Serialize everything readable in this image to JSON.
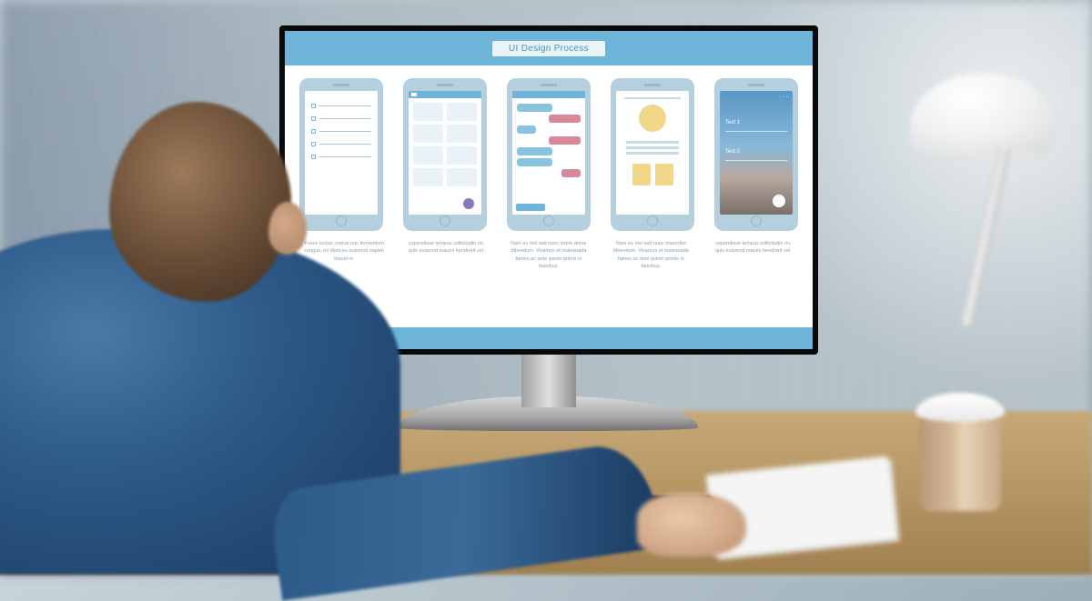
{
  "screen": {
    "title": "UI Design Process",
    "mockups": [
      {
        "caption": "Fusce luctus, metus non fermentum congue, mi diam eu euismod sapien blandi in."
      },
      {
        "caption": "uspendisse tempus sollicitudin mi, quis euismod mauris hendrerit vel."
      },
      {
        "caption": "Nam eu nisl sed nunc lorem donor bibendum. Vivamus et malesuada fames ac ante ipsum primis in faucibus."
      },
      {
        "caption": "Nam eu nisl sed nunc imperdiet bibendum. Vivamus et malesuada fames ac ante ipsum primis in faucibus."
      },
      {
        "caption": "uspendisse tempus sollicitudin mi, quis euismod mauris hendrerit vel."
      }
    ],
    "mockup5": {
      "label1": "Text 1",
      "label2": "Text 2"
    }
  },
  "colors": {
    "header": "#6db4d8",
    "phone": "#b4cfdd",
    "accentYellow": "#f0d888",
    "accentPink": "#d88898",
    "accentPurple": "#8878b8"
  }
}
